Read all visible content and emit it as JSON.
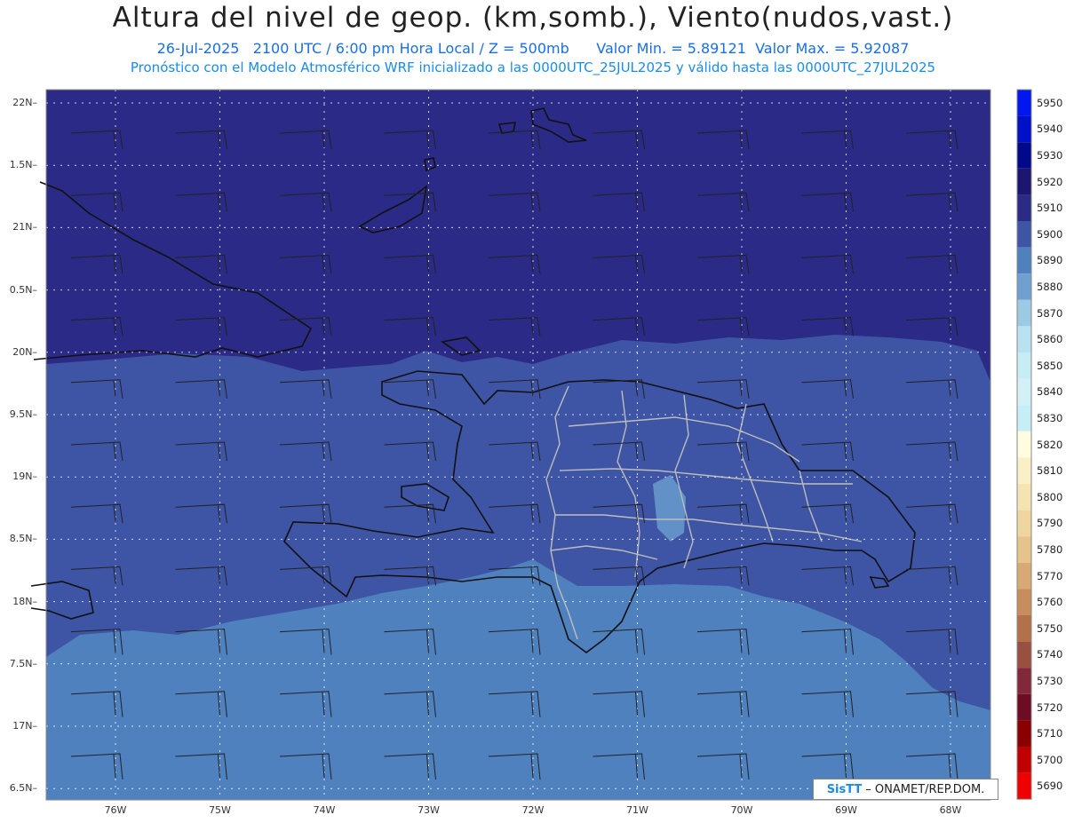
{
  "header": {
    "title": "Altura del nivel de geop. (km,somb.), Viento(nudos,vast.)",
    "subtitle": "26-Jul-2025   2100 UTC / 6:00 pm Hora Local / Z = 500mb      Valor Min. = 5.89121  Valor Max. = 5.92087",
    "info": "Pronóstico con el Modelo Atmosférico WRF inicializado a las 0000UTC_25JUL2025 y válido hasta las  0000UTC_27JUL2025"
  },
  "map": {
    "lat_labels": [
      "22N",
      "1.5N",
      "21N",
      "0.5N",
      "20N",
      "9.5N",
      "19N",
      "8.5N",
      "18N",
      "7.5N",
      "17N",
      "6.5N"
    ],
    "lon_labels": [
      "76W",
      "75W",
      "74W",
      "73W",
      "72W",
      "71W",
      "70W",
      "69W",
      "68W"
    ],
    "fill_colors": {
      "z5910": "#2b2a86",
      "z5900": "#3e54a4",
      "z5890": "#4e81be",
      "z5880": "#6191c7"
    }
  },
  "colorbar": {
    "levels": [
      "5950",
      "5940",
      "5930",
      "5920",
      "5910",
      "5900",
      "5890",
      "5880",
      "5870",
      "5860",
      "5850",
      "5840",
      "5830",
      "5820",
      "5810",
      "5800",
      "5790",
      "5780",
      "5770",
      "5760",
      "5750",
      "5740",
      "5730",
      "5720",
      "5710",
      "5700",
      "5690"
    ],
    "colors": [
      "#0018f0",
      "#0010c8",
      "#00088c",
      "#1c1670",
      "#2b2a86",
      "#3e54a4",
      "#4e81be",
      "#6fa0cf",
      "#9cc9e4",
      "#b8e2ef",
      "#c8ecf4",
      "#d4f0f7",
      "#c7eef6",
      "#fffce0",
      "#faf0c8",
      "#f4e4b4",
      "#efd6a0",
      "#e6c38a",
      "#d7a974",
      "#c78d5c",
      "#b2714a",
      "#9a5040",
      "#82283a",
      "#6e0c24",
      "#8a0000",
      "#c00000",
      "#f00000"
    ]
  },
  "credit": {
    "logo": "SisTT",
    "text": "– ONAMET/REP.DOM."
  }
}
